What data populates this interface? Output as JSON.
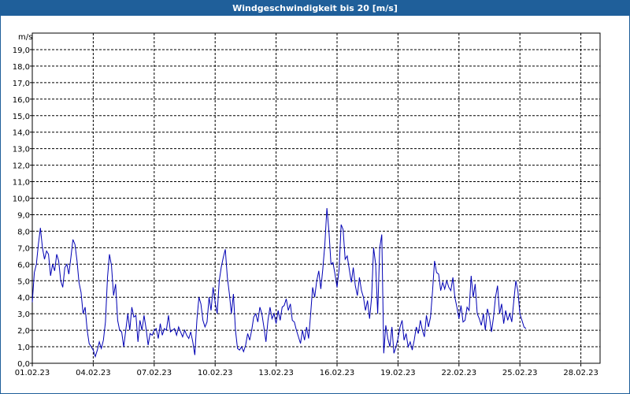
{
  "window": {
    "title": "Windgeschwindigkeit bis 20 [m/s]"
  },
  "colors": {
    "title_bar": "#1f5f9a",
    "series": "#0000b4",
    "grid": "#000000",
    "background": "#ffffff"
  },
  "chart_data": {
    "type": "line",
    "title": "Windgeschwindigkeit bis 20 [m/s]",
    "ylabel": "m/s",
    "xlabel": "",
    "ylim": [
      0,
      20
    ],
    "xlim": [
      0,
      28.6
    ],
    "grid": true,
    "legend": "none",
    "y_ticks": [
      "0,0",
      "1,0",
      "2,0",
      "3,0",
      "4,0",
      "5,0",
      "6,0",
      "7,0",
      "8,0",
      "9,0",
      "10,0",
      "11,0",
      "12,0",
      "13,0",
      "14,0",
      "15,0",
      "16,0",
      "17,0",
      "18,0",
      "19,0"
    ],
    "x_ticks": [
      {
        "day": 0,
        "label": "01.02.23"
      },
      {
        "day": 3,
        "label": "04.02.23"
      },
      {
        "day": 6,
        "label": "07.02.23"
      },
      {
        "day": 9,
        "label": "10.02.23"
      },
      {
        "day": 12,
        "label": "13.02.23"
      },
      {
        "day": 15,
        "label": "16.02.23"
      },
      {
        "day": 18,
        "label": "19.02.23"
      },
      {
        "day": 21,
        "label": "22.02.23"
      },
      {
        "day": 24,
        "label": "25.02.23"
      },
      {
        "day": 27,
        "label": "28.02.23"
      }
    ],
    "series": [
      {
        "color": "#0000b4",
        "points": [
          [
            0.0,
            3.7
          ],
          [
            0.1,
            5.5
          ],
          [
            0.2,
            6.0
          ],
          [
            0.3,
            7.2
          ],
          [
            0.4,
            8.2
          ],
          [
            0.5,
            7.0
          ],
          [
            0.6,
            6.3
          ],
          [
            0.7,
            6.8
          ],
          [
            0.8,
            6.6
          ],
          [
            0.9,
            5.3
          ],
          [
            1.0,
            6.0
          ],
          [
            1.1,
            5.6
          ],
          [
            1.2,
            6.6
          ],
          [
            1.3,
            6.2
          ],
          [
            1.4,
            5.0
          ],
          [
            1.5,
            4.6
          ],
          [
            1.6,
            5.8
          ],
          [
            1.7,
            6.0
          ],
          [
            1.8,
            5.4
          ],
          [
            1.9,
            6.4
          ],
          [
            2.0,
            7.5
          ],
          [
            2.1,
            7.2
          ],
          [
            2.2,
            6.2
          ],
          [
            2.3,
            4.9
          ],
          [
            2.4,
            4.3
          ],
          [
            2.5,
            3.0
          ],
          [
            2.6,
            3.4
          ],
          [
            2.7,
            2.0
          ],
          [
            2.8,
            1.2
          ],
          [
            2.9,
            1.0
          ],
          [
            3.0,
            0.8
          ],
          [
            3.1,
            0.4
          ],
          [
            3.2,
            0.8
          ],
          [
            3.3,
            1.3
          ],
          [
            3.4,
            0.9
          ],
          [
            3.5,
            1.4
          ],
          [
            3.6,
            2.5
          ],
          [
            3.7,
            5.2
          ],
          [
            3.8,
            6.6
          ],
          [
            3.9,
            5.9
          ],
          [
            4.0,
            4.1
          ],
          [
            4.1,
            4.8
          ],
          [
            4.2,
            2.6
          ],
          [
            4.3,
            2.0
          ],
          [
            4.4,
            1.9
          ],
          [
            4.5,
            1.0
          ],
          [
            4.6,
            2.0
          ],
          [
            4.7,
            3.0
          ],
          [
            4.8,
            2.0
          ],
          [
            4.9,
            3.4
          ],
          [
            5.0,
            2.8
          ],
          [
            5.1,
            2.9
          ],
          [
            5.2,
            1.3
          ],
          [
            5.3,
            2.6
          ],
          [
            5.4,
            2.0
          ],
          [
            5.5,
            2.9
          ],
          [
            5.6,
            2.1
          ],
          [
            5.7,
            1.1
          ],
          [
            5.8,
            1.8
          ],
          [
            5.9,
            1.7
          ],
          [
            6.0,
            2.0
          ],
          [
            6.1,
            2.1
          ],
          [
            6.2,
            1.5
          ],
          [
            6.3,
            2.4
          ],
          [
            6.4,
            1.7
          ],
          [
            6.5,
            2.1
          ],
          [
            6.6,
            2.0
          ],
          [
            6.7,
            2.9
          ],
          [
            6.8,
            1.9
          ],
          [
            6.9,
            2.0
          ],
          [
            7.0,
            2.1
          ],
          [
            7.1,
            1.7
          ],
          [
            7.2,
            2.2
          ],
          [
            7.3,
            1.9
          ],
          [
            7.4,
            1.6
          ],
          [
            7.5,
            2.0
          ],
          [
            7.6,
            1.7
          ],
          [
            7.7,
            1.5
          ],
          [
            7.8,
            1.9
          ],
          [
            7.9,
            1.3
          ],
          [
            8.0,
            0.5
          ],
          [
            8.1,
            2.6
          ],
          [
            8.2,
            4.0
          ],
          [
            8.3,
            3.6
          ],
          [
            8.4,
            2.6
          ],
          [
            8.5,
            2.2
          ],
          [
            8.6,
            2.5
          ],
          [
            8.7,
            4.0
          ],
          [
            8.8,
            3.2
          ],
          [
            8.9,
            4.6
          ],
          [
            9.0,
            3.7
          ],
          [
            9.1,
            3.0
          ],
          [
            9.2,
            5.0
          ],
          [
            9.3,
            5.8
          ],
          [
            9.4,
            6.4
          ],
          [
            9.5,
            6.9
          ],
          [
            9.6,
            5.2
          ],
          [
            9.7,
            4.2
          ],
          [
            9.8,
            3.0
          ],
          [
            9.9,
            4.2
          ],
          [
            10.0,
            2.0
          ],
          [
            10.1,
            0.9
          ],
          [
            10.2,
            0.8
          ],
          [
            10.3,
            1.0
          ],
          [
            10.4,
            0.7
          ],
          [
            10.5,
            1.1
          ],
          [
            10.6,
            1.8
          ],
          [
            10.7,
            1.4
          ],
          [
            10.8,
            2.0
          ],
          [
            10.9,
            2.8
          ],
          [
            11.0,
            3.0
          ],
          [
            11.1,
            2.5
          ],
          [
            11.2,
            3.4
          ],
          [
            11.3,
            3.0
          ],
          [
            11.4,
            2.2
          ],
          [
            11.5,
            1.3
          ],
          [
            11.6,
            2.6
          ],
          [
            11.7,
            3.4
          ],
          [
            11.8,
            2.7
          ],
          [
            11.9,
            3.0
          ],
          [
            12.0,
            2.4
          ],
          [
            12.1,
            3.2
          ],
          [
            12.2,
            2.6
          ],
          [
            12.3,
            3.4
          ],
          [
            12.4,
            3.5
          ],
          [
            12.5,
            3.9
          ],
          [
            12.6,
            3.2
          ],
          [
            12.7,
            3.6
          ],
          [
            12.8,
            2.6
          ],
          [
            12.9,
            2.5
          ],
          [
            13.0,
            2.0
          ],
          [
            13.1,
            1.6
          ],
          [
            13.2,
            1.2
          ],
          [
            13.3,
            2.0
          ],
          [
            13.4,
            1.4
          ],
          [
            13.5,
            2.2
          ],
          [
            13.6,
            1.5
          ],
          [
            13.7,
            3.0
          ],
          [
            13.8,
            4.6
          ],
          [
            13.9,
            4.0
          ],
          [
            14.0,
            5.0
          ],
          [
            14.1,
            5.6
          ],
          [
            14.2,
            4.5
          ],
          [
            14.3,
            5.7
          ],
          [
            14.4,
            7.2
          ],
          [
            14.5,
            9.4
          ],
          [
            14.6,
            8.0
          ],
          [
            14.7,
            6.0
          ],
          [
            14.8,
            6.1
          ],
          [
            14.9,
            5.4
          ],
          [
            15.0,
            4.6
          ],
          [
            15.1,
            5.7
          ],
          [
            15.2,
            8.4
          ],
          [
            15.3,
            8.1
          ],
          [
            15.4,
            6.3
          ],
          [
            15.5,
            6.5
          ],
          [
            15.6,
            5.7
          ],
          [
            15.7,
            4.9
          ],
          [
            15.8,
            5.8
          ],
          [
            15.9,
            4.7
          ],
          [
            16.0,
            4.1
          ],
          [
            16.1,
            5.2
          ],
          [
            16.2,
            4.4
          ],
          [
            16.3,
            4.0
          ],
          [
            16.4,
            3.2
          ],
          [
            16.5,
            3.8
          ],
          [
            16.6,
            2.7
          ],
          [
            16.7,
            4.0
          ],
          [
            16.8,
            7.0
          ],
          [
            16.9,
            6.0
          ],
          [
            17.0,
            3.0
          ],
          [
            17.1,
            7.0
          ],
          [
            17.2,
            7.8
          ],
          [
            17.3,
            0.6
          ],
          [
            17.4,
            2.3
          ],
          [
            17.5,
            1.5
          ],
          [
            17.6,
            1.0
          ],
          [
            17.7,
            2.2
          ],
          [
            17.8,
            0.6
          ],
          [
            17.9,
            1.0
          ],
          [
            18.0,
            1.5
          ],
          [
            18.1,
            2.2
          ],
          [
            18.2,
            2.6
          ],
          [
            18.3,
            1.4
          ],
          [
            18.4,
            1.8
          ],
          [
            18.5,
            1.0
          ],
          [
            18.6,
            1.3
          ],
          [
            18.7,
            0.8
          ],
          [
            18.8,
            1.4
          ],
          [
            18.9,
            2.2
          ],
          [
            19.0,
            1.8
          ],
          [
            19.1,
            2.6
          ],
          [
            19.2,
            2.0
          ],
          [
            19.3,
            1.6
          ],
          [
            19.4,
            2.9
          ],
          [
            19.5,
            2.2
          ],
          [
            19.6,
            2.8
          ],
          [
            19.7,
            4.4
          ],
          [
            19.8,
            6.2
          ],
          [
            19.9,
            5.5
          ],
          [
            20.0,
            5.4
          ],
          [
            20.1,
            4.4
          ],
          [
            20.2,
            4.9
          ],
          [
            20.3,
            4.5
          ],
          [
            20.4,
            5.0
          ],
          [
            20.5,
            4.6
          ],
          [
            20.6,
            4.4
          ],
          [
            20.7,
            5.2
          ],
          [
            20.8,
            4.0
          ],
          [
            20.9,
            3.4
          ],
          [
            21.0,
            2.7
          ],
          [
            21.1,
            3.5
          ],
          [
            21.2,
            2.5
          ],
          [
            21.3,
            2.6
          ],
          [
            21.4,
            3.4
          ],
          [
            21.5,
            3.2
          ],
          [
            21.6,
            5.3
          ],
          [
            21.7,
            4.0
          ],
          [
            21.8,
            4.8
          ],
          [
            21.9,
            3.0
          ],
          [
            22.0,
            2.7
          ],
          [
            22.1,
            2.3
          ],
          [
            22.2,
            3.0
          ],
          [
            22.3,
            2.0
          ],
          [
            22.4,
            3.3
          ],
          [
            22.5,
            2.8
          ],
          [
            22.6,
            1.9
          ],
          [
            22.7,
            2.8
          ],
          [
            22.8,
            4.0
          ],
          [
            22.9,
            4.7
          ],
          [
            23.0,
            3.0
          ],
          [
            23.1,
            3.6
          ],
          [
            23.2,
            2.4
          ],
          [
            23.3,
            3.2
          ],
          [
            23.4,
            2.6
          ],
          [
            23.5,
            3.0
          ],
          [
            23.6,
            2.5
          ],
          [
            23.7,
            3.8
          ],
          [
            23.8,
            5.0
          ],
          [
            23.9,
            4.4
          ],
          [
            24.0,
            3.0
          ],
          [
            24.1,
            2.6
          ],
          [
            24.2,
            2.2
          ],
          [
            24.3,
            2.1
          ]
        ]
      }
    ]
  }
}
